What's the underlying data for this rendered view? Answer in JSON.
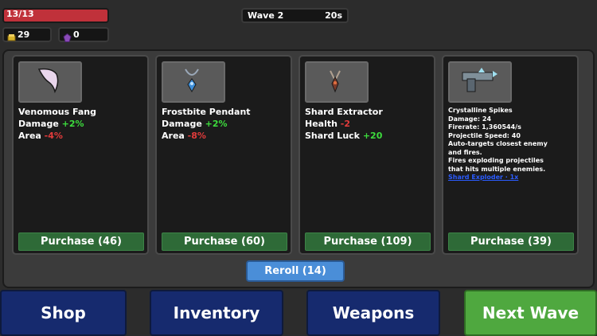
{
  "hud": {
    "health_text": "13/13",
    "health_fraction": 1.0,
    "coins": "29",
    "gems": "0",
    "wave_label": "Wave 2",
    "wave_timer": "20s"
  },
  "cards": [
    {
      "name": "Venomous Fang",
      "icon": "fang-icon",
      "stats": [
        {
          "label": "Damage",
          "value": "+2%",
          "sign": "pos"
        },
        {
          "label": "Area",
          "value": "-4%",
          "sign": "neg"
        }
      ],
      "purchase": "Purchase (46)"
    },
    {
      "name": "Frostbite Pendant",
      "icon": "pendant-icon",
      "stats": [
        {
          "label": "Damage",
          "value": "+2%",
          "sign": "pos"
        },
        {
          "label": "Area",
          "value": "-8%",
          "sign": "neg"
        }
      ],
      "purchase": "Purchase (60)"
    },
    {
      "name": "Shard Extractor",
      "icon": "extractor-icon",
      "stats": [
        {
          "label": "Health",
          "value": "-2",
          "sign": "neg"
        },
        {
          "label": "Shard Luck",
          "value": "+20",
          "sign": "pos"
        }
      ],
      "purchase": "Purchase (109)"
    },
    {
      "name": "Crystalline Spikes",
      "icon": "spike-gun-icon",
      "lines": [
        "Damage: 24",
        "Firerate: 1,360544/s",
        "Projectile Speed: 40",
        "Auto-targets closest enemy",
        "and fires.",
        "Fires exploding projectiles",
        "that hits multiple enemies."
      ],
      "link": "Shard Exploder · 1x",
      "purchase": "Purchase (39)"
    }
  ],
  "reroll": "Reroll (14)",
  "nav": {
    "shop": "Shop",
    "inventory": "Inventory",
    "weapons": "Weapons",
    "next_wave": "Next Wave"
  },
  "colors": {
    "health": "#c0313a",
    "positive": "#3ddc3d",
    "negative": "#e23b3b",
    "purchase": "#2e6a37",
    "reroll": "#4a8ed8",
    "nav_blue": "#162a6e",
    "next_wave": "#4fa83f"
  }
}
